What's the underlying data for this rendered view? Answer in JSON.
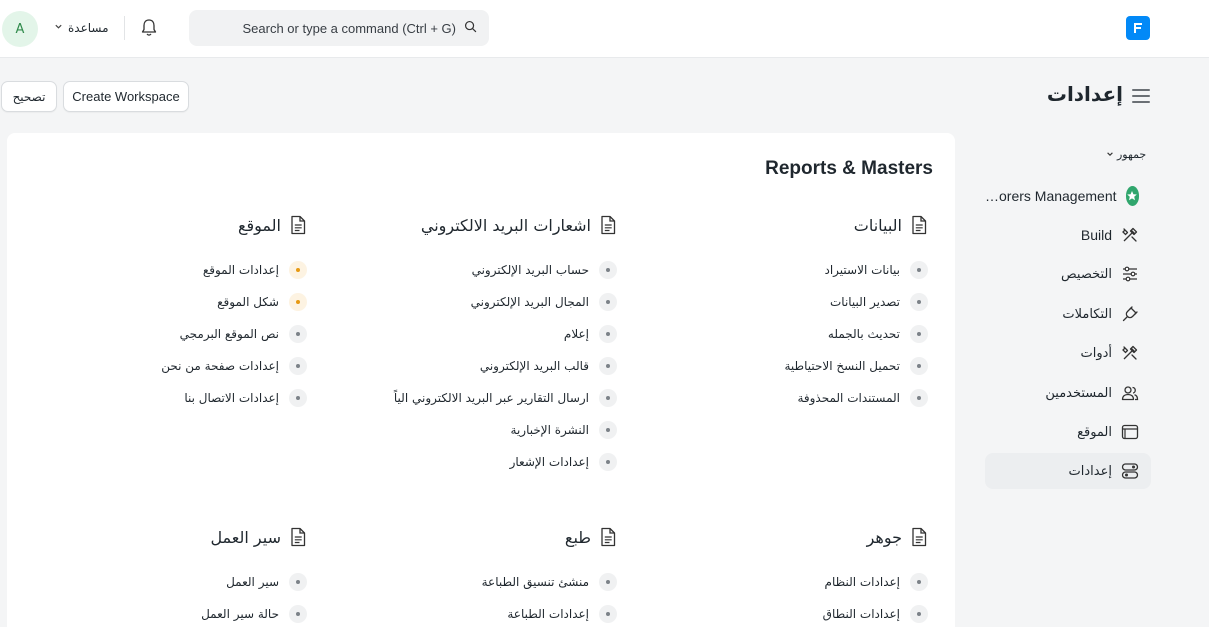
{
  "navbar": {
    "avatar_letter": "A",
    "help_label": "مساعدة",
    "search_placeholder": "Search or type a command (Ctrl + G)",
    "logo_letter": "F",
    "icons": {
      "bell": "bell-icon",
      "search": "search-icon",
      "chevron": "chevron-down-icon"
    }
  },
  "page": {
    "title": "إعدادات",
    "create_workspace": "Create Workspace",
    "fix_button": "تصحيح"
  },
  "sidebar": {
    "workspace_switch": "جمهور",
    "items": [
      {
        "label": "…orers Management",
        "icon": "star-icon",
        "active": false
      },
      {
        "label": "Build",
        "icon": "tools-icon",
        "active": false
      },
      {
        "label": "التخصيص",
        "icon": "sliders-icon",
        "active": false
      },
      {
        "label": "التكاملات",
        "icon": "plug-icon",
        "active": false
      },
      {
        "label": "أدوات",
        "icon": "tools-icon",
        "active": false
      },
      {
        "label": "المستخدمين",
        "icon": "users-icon",
        "active": false
      },
      {
        "label": "الموقع",
        "icon": "browser-icon",
        "active": false
      },
      {
        "label": "إعدادات",
        "icon": "settings-toggle-icon",
        "active": true
      }
    ]
  },
  "main": {
    "title": "Reports & Masters",
    "sections": [
      {
        "heading": "البيانات",
        "links": [
          {
            "label": "بيانات الاستيراد",
            "dot": "gray"
          },
          {
            "label": "تصدير البيانات",
            "dot": "gray"
          },
          {
            "label": "تحديث بالجمله",
            "dot": "gray"
          },
          {
            "label": "تحميل النسخ الاحتياطية",
            "dot": "gray"
          },
          {
            "label": "المستندات المحذوفة",
            "dot": "gray"
          }
        ]
      },
      {
        "heading": "اشعارات البريد الالكتروني",
        "links": [
          {
            "label": "حساب البريد الإلكتروني",
            "dot": "gray"
          },
          {
            "label": "المجال البريد الإلكتروني",
            "dot": "gray"
          },
          {
            "label": "إعلام",
            "dot": "gray"
          },
          {
            "label": "قالب البريد الإلكتروني",
            "dot": "gray"
          },
          {
            "label": "ارسال التقارير عبر البريد الالكتروني الياً",
            "dot": "gray"
          },
          {
            "label": "النشرة الإخبارية",
            "dot": "gray"
          },
          {
            "label": "إعدادات الإشعار",
            "dot": "gray"
          }
        ]
      },
      {
        "heading": "الموقع",
        "links": [
          {
            "label": "إعدادات الموقع",
            "dot": "orange"
          },
          {
            "label": "شكل الموقع",
            "dot": "orange"
          },
          {
            "label": "نص الموقع البرمجي",
            "dot": "gray"
          },
          {
            "label": "إعدادات صفحة من نحن",
            "dot": "gray"
          },
          {
            "label": "إعدادات الاتصال بنا",
            "dot": "gray"
          }
        ]
      },
      {
        "heading": "جوهر",
        "links": [
          {
            "label": "إعدادات النظام",
            "dot": "gray"
          },
          {
            "label": "إعدادات النطاق",
            "dot": "gray"
          }
        ]
      },
      {
        "heading": "طبع",
        "links": [
          {
            "label": "منشئ تنسيق الطباعة",
            "dot": "gray"
          },
          {
            "label": "إعدادات الطباعة",
            "dot": "gray"
          }
        ]
      },
      {
        "heading": "سير العمل",
        "links": [
          {
            "label": "سير العمل",
            "dot": "gray"
          },
          {
            "label": "حالة سير العمل",
            "dot": "gray"
          }
        ]
      }
    ]
  },
  "colors": {
    "brand": "#0289f7",
    "accent_green": "#30a66d",
    "warning_dot": "#e79913"
  }
}
